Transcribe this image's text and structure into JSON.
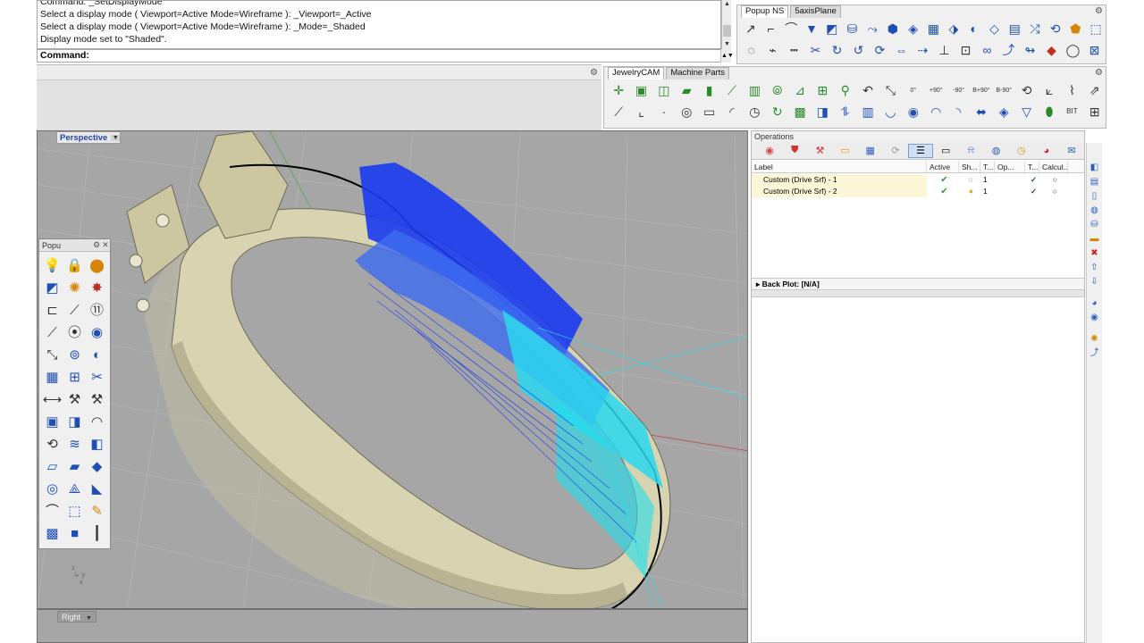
{
  "command": {
    "history": [
      "Command: _SetDisplayMode",
      "Select a display mode ( Viewport=Active  Mode=Wireframe ): _Viewport=_Active",
      "Select a display mode ( Viewport=Active  Mode=Wireframe ): _Mode=_Shaded",
      "Display mode set to \"Shaded\"."
    ],
    "prompt": "Command:"
  },
  "toolbar_top": {
    "tabs": [
      "Popup NS",
      "5axisPlane"
    ]
  },
  "toolbar_jewelry": {
    "tabs": [
      "JewelryCAM",
      "Machine Parts"
    ],
    "labels": [
      "0°",
      "+90°",
      "-90°",
      "B+90°",
      "B-90°",
      "BIT"
    ]
  },
  "viewport": {
    "name": "Perspective"
  },
  "right_viewport": {
    "name": "Right"
  },
  "floating_toolbar": {
    "title": "Popu"
  },
  "operations": {
    "title": "Operations",
    "columns": [
      "Label",
      "Active",
      "Sh...",
      "T...",
      "Op...",
      "T...",
      "Calcul..."
    ],
    "rows": [
      {
        "label": "Custom (Drive Srf) - 1",
        "t": "1"
      },
      {
        "label": "Custom (Drive Srf) - 2",
        "t": "1"
      }
    ],
    "backplot": "Back Plot: [N/A]"
  },
  "colors": {
    "viewport_bg": "#a6a6a6",
    "ring_gold": "#d8d3b0",
    "toolpath_blue": "#1133ee",
    "toolpath_cyan": "#22e0ee",
    "accent_blue": "#2347a6"
  }
}
